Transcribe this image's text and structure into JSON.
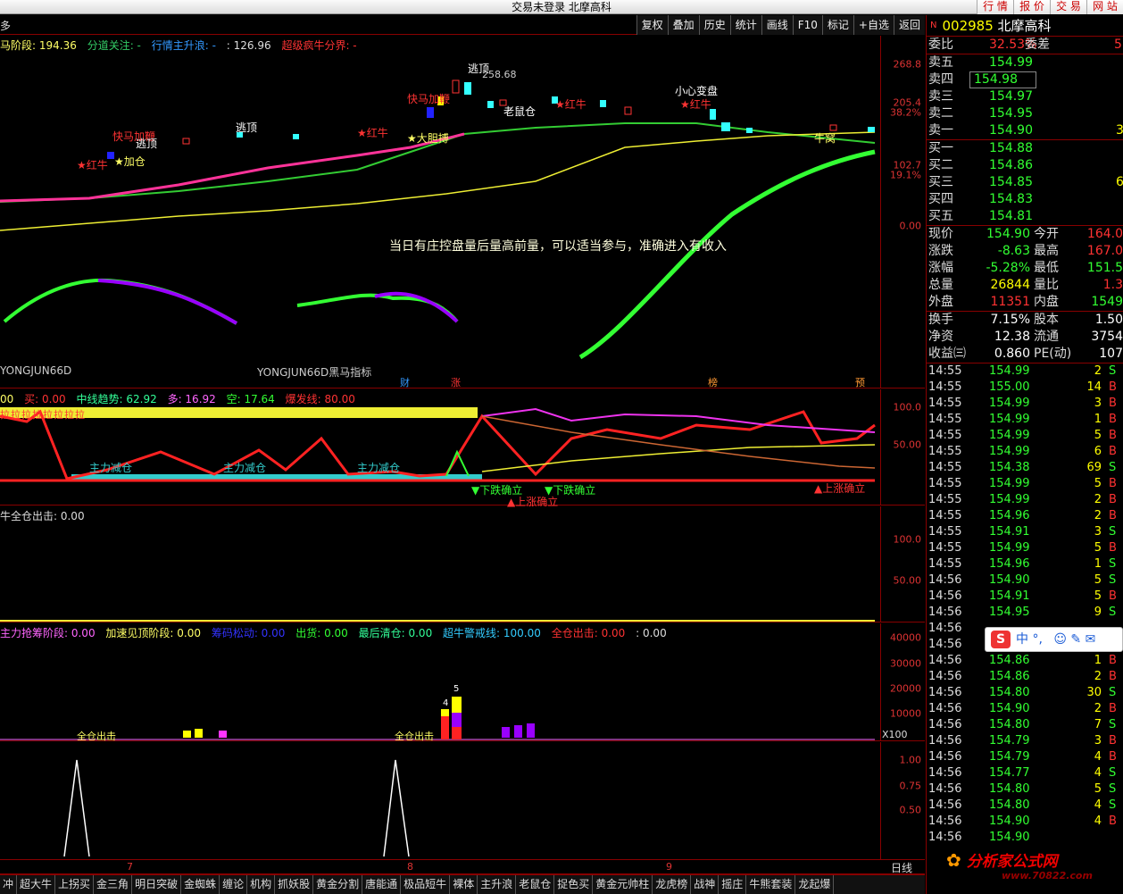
{
  "window": {
    "title": "交易未登录 北摩高科",
    "buttons": [
      "行 情",
      "报 价",
      "交 易",
      "网 站"
    ]
  },
  "toolbar": {
    "left": "多",
    "buttons": [
      "复权",
      "叠加",
      "历史",
      "统计",
      "画线",
      "F10",
      "标记",
      "+自选",
      "返回"
    ]
  },
  "main": {
    "legend": [
      {
        "text": "马阶段: 194.36",
        "color": "#ffff66"
      },
      {
        "text": "分道关注: -",
        "color": "#33cc66"
      },
      {
        "text": "行情主升浪: -",
        "color": "#3399ff"
      },
      {
        "text": ": 126.96",
        "color": "#dddddd"
      },
      {
        "text": "超级疯牛分界: -",
        "color": "#ff3333"
      }
    ],
    "axis": [
      "268.8",
      "205.4",
      "38.2%",
      "102.7",
      "19.1%",
      "0.00"
    ],
    "notes": [
      "当日有庄控盘量后量高前量，可以适当参与，准确进入有收入",
      "YONGJUN66D",
      "YONGJUN66D黑马指标"
    ],
    "signals": [
      "快马加鞭",
      "逃顶",
      "★加仓",
      "★红牛",
      "逃顶",
      "★红牛",
      "快马加鞭",
      "★大胆搏",
      "逃顶",
      "258.68",
      "老鼠仓",
      "★红牛",
      "小心变盘",
      "★红牛",
      "牛窝"
    ],
    "badges": [
      "财",
      "涨",
      "榜",
      "预"
    ]
  },
  "panel2": {
    "legend": [
      {
        "text": "00",
        "color": "#ffff66"
      },
      {
        "text": "买: 0.00",
        "color": "#ff3333"
      },
      {
        "text": "中线趋势: 62.92",
        "color": "#33ff99"
      },
      {
        "text": "多: 16.92",
        "color": "#ff66ff"
      },
      {
        "text": "空: 17.64",
        "color": "#33ff33"
      },
      {
        "text": "爆发线: 80.00",
        "color": "#ff3333"
      }
    ],
    "axis": [
      "100.0",
      "50.00"
    ],
    "labels": [
      "主力减仓",
      "主力减仓",
      "主力减仓",
      "▼下跌确立",
      "▼下跌确立",
      "▲上涨确立",
      "▲上涨确立"
    ],
    "bar_text": "拉拉拉拉拉拉拉拉"
  },
  "panel3": {
    "legend": [
      {
        "text": "牛全仓出击: 0.00",
        "color": "#dddddd"
      }
    ],
    "axis": [
      "100.0",
      "50.00"
    ]
  },
  "panel4": {
    "legend": [
      {
        "text": "主力抢筹阶段: 0.00",
        "color": "#ff66ff"
      },
      {
        "text": "加速见顶阶段: 0.00",
        "color": "#ffff66"
      },
      {
        "text": "筹码松动: 0.00",
        "color": "#3333ff"
      },
      {
        "text": "出货: 0.00",
        "color": "#33ff33"
      },
      {
        "text": "最后清仓: 0.00",
        "color": "#33ff99"
      },
      {
        "text": "超牛警戒线: 100.00",
        "color": "#33ccff"
      },
      {
        "text": "全仓出击: 0.00",
        "color": "#ff3333"
      },
      {
        "text": ": 0.00",
        "color": "#dddddd"
      }
    ],
    "axis": [
      "40000",
      "30000",
      "20000",
      "10000"
    ],
    "labels": [
      "全仓出击",
      "全仓出击",
      "4",
      "5"
    ],
    "unit": "X100"
  },
  "panel5": {
    "axis": [
      "1.00",
      "0.75",
      "0.50"
    ]
  },
  "dates": [
    "7",
    "8",
    "9"
  ],
  "quote": {
    "header": {
      "flag": "N",
      "code": "002985",
      "name": "北摩高科"
    },
    "wb": {
      "label1": "委比",
      "val1": "32.53%",
      "label2": "委差",
      "val2": "5"
    },
    "asks": [
      {
        "label": "卖五",
        "price": "154.99"
      },
      {
        "label": "卖四",
        "price": "154.98"
      },
      {
        "label": "卖三",
        "price": "154.97"
      },
      {
        "label": "卖二",
        "price": "154.95"
      },
      {
        "label": "卖一",
        "price": "154.90",
        "vol": "3"
      }
    ],
    "bids": [
      {
        "label": "买一",
        "price": "154.88"
      },
      {
        "label": "买二",
        "price": "154.86"
      },
      {
        "label": "买三",
        "price": "154.85",
        "vol": "6"
      },
      {
        "label": "买四",
        "price": "154.83"
      },
      {
        "label": "买五",
        "price": "154.81"
      }
    ],
    "stats": [
      {
        "a": "现价",
        "b": "154.90",
        "bc": "grn",
        "c": "今开",
        "d": "164.0",
        "dc": "red"
      },
      {
        "a": "涨跌",
        "b": "-8.63",
        "bc": "grn",
        "c": "最高",
        "d": "167.0",
        "dc": "red"
      },
      {
        "a": "涨幅",
        "b": "-5.28%",
        "bc": "grn",
        "c": "最低",
        "d": "151.5",
        "dc": "grn"
      },
      {
        "a": "总量",
        "b": "26844",
        "bc": "yel",
        "c": "量比",
        "d": "1.3",
        "dc": "red"
      },
      {
        "a": "外盘",
        "b": "11351",
        "bc": "red",
        "c": "内盘",
        "d": "1549",
        "dc": "grn"
      }
    ],
    "stats2": [
      {
        "a": "换手",
        "b": "7.15%",
        "bc": "wht",
        "c": "股本",
        "d": "1.50",
        "dc": "wht"
      },
      {
        "a": "净资",
        "b": "12.38",
        "bc": "wht",
        "c": "流通",
        "d": "3754",
        "dc": "wht"
      },
      {
        "a": "收益㈢",
        "b": "0.860",
        "bc": "wht",
        "c": "PE(动)",
        "d": "107",
        "dc": "wht"
      }
    ],
    "ticks": [
      {
        "t": "14:55",
        "p": "154.99",
        "v": "2",
        "s": "S"
      },
      {
        "t": "14:55",
        "p": "155.00",
        "v": "14",
        "s": "B"
      },
      {
        "t": "14:55",
        "p": "154.99",
        "v": "3",
        "s": "B"
      },
      {
        "t": "14:55",
        "p": "154.99",
        "v": "1",
        "s": "B"
      },
      {
        "t": "14:55",
        "p": "154.99",
        "v": "5",
        "s": "B"
      },
      {
        "t": "14:55",
        "p": "154.99",
        "v": "6",
        "s": "B"
      },
      {
        "t": "14:55",
        "p": "154.38",
        "v": "69",
        "s": "S"
      },
      {
        "t": "14:55",
        "p": "154.99",
        "v": "5",
        "s": "B"
      },
      {
        "t": "14:55",
        "p": "154.99",
        "v": "2",
        "s": "B"
      },
      {
        "t": "14:55",
        "p": "154.96",
        "v": "2",
        "s": "B"
      },
      {
        "t": "14:55",
        "p": "154.91",
        "v": "3",
        "s": "S"
      },
      {
        "t": "14:55",
        "p": "154.99",
        "v": "5",
        "s": "B"
      },
      {
        "t": "14:55",
        "p": "154.96",
        "v": "1",
        "s": "S"
      },
      {
        "t": "14:56",
        "p": "154.90",
        "v": "5",
        "s": "S"
      },
      {
        "t": "14:56",
        "p": "154.91",
        "v": "5",
        "s": "B"
      },
      {
        "t": "14:56",
        "p": "154.95",
        "v": "9",
        "s": "S"
      },
      {
        "t": "14:56",
        "p": "",
        "v": "",
        "s": ""
      },
      {
        "t": "14:56",
        "p": "154.80",
        "v": "11",
        "s": "S"
      },
      {
        "t": "14:56",
        "p": "154.86",
        "v": "1",
        "s": "B"
      },
      {
        "t": "14:56",
        "p": "154.86",
        "v": "2",
        "s": "B"
      },
      {
        "t": "14:56",
        "p": "154.80",
        "v": "30",
        "s": "S"
      },
      {
        "t": "14:56",
        "p": "154.90",
        "v": "2",
        "s": "B"
      },
      {
        "t": "14:56",
        "p": "154.80",
        "v": "7",
        "s": "S"
      },
      {
        "t": "14:56",
        "p": "154.79",
        "v": "3",
        "s": "B"
      },
      {
        "t": "14:56",
        "p": "154.79",
        "v": "4",
        "s": "B"
      },
      {
        "t": "14:56",
        "p": "154.77",
        "v": "4",
        "s": "S"
      },
      {
        "t": "14:56",
        "p": "154.80",
        "v": "5",
        "s": "S"
      },
      {
        "t": "14:56",
        "p": "154.80",
        "v": "4",
        "s": "S"
      },
      {
        "t": "14:56",
        "p": "154.90",
        "v": "4",
        "s": "B"
      },
      {
        "t": "14:56",
        "p": "154.90",
        "v": "",
        "s": ""
      }
    ],
    "daytab": "日线"
  },
  "tabs": [
    "冲",
    "超大牛",
    "上拐买",
    "金三角",
    "明日突破",
    "金蜘蛛",
    "缠论",
    "机构",
    "抓妖股",
    "黄金分割",
    "唐能通",
    "极品短牛",
    "裸体",
    "主升浪",
    "老鼠仓",
    "捉色买",
    "黄金元帅柱",
    "龙虎榜",
    "战神",
    "摇庄",
    "牛熊套装",
    "龙起爆"
  ],
  "ime": {
    "logo": "S",
    "text": "中 °,"
  },
  "watermark": {
    "text": "分析家公式网",
    "url": "www.70822.com"
  }
}
